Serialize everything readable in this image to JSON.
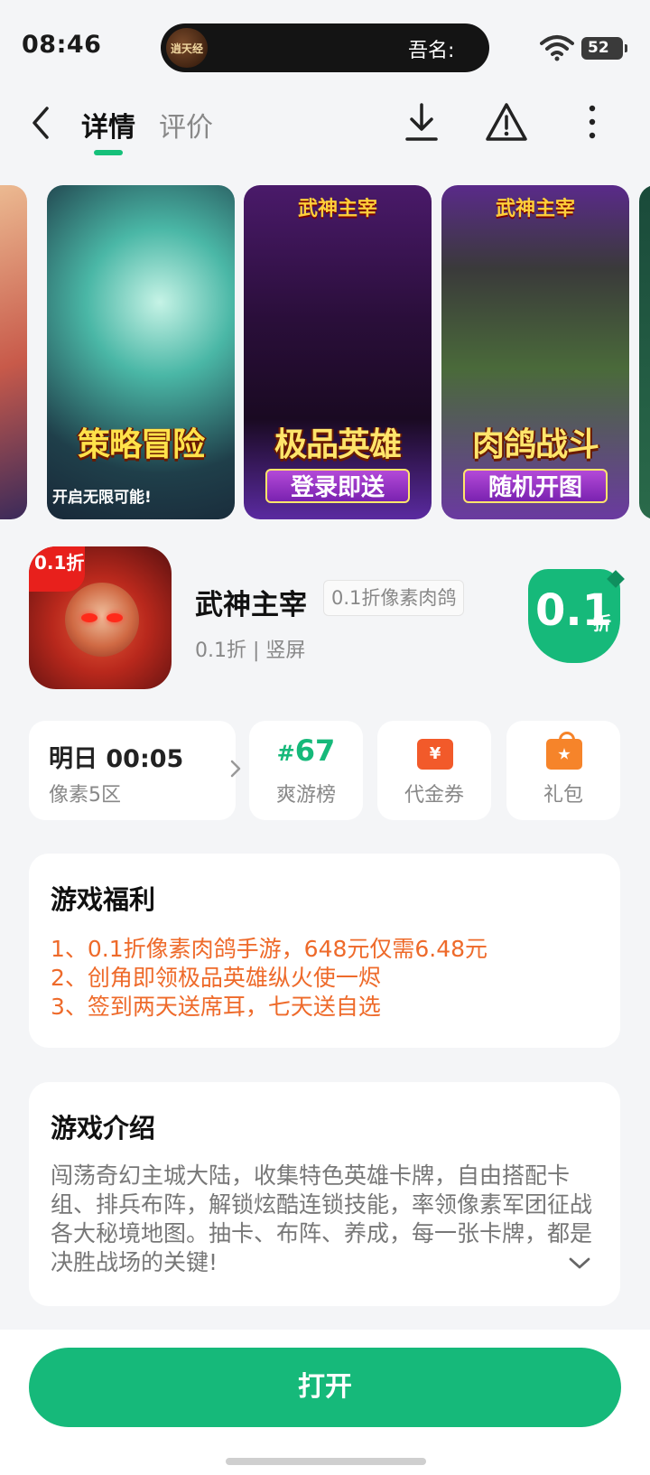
{
  "status_bar": {
    "time": "08:46",
    "island_text": "吾名:",
    "island_logo": "逍天经",
    "battery": "52"
  },
  "nav": {
    "tabs": [
      {
        "label": "详情",
        "active": true
      },
      {
        "label": "评价",
        "active": false
      }
    ],
    "icons": [
      "back-icon",
      "download-icon",
      "warning-icon",
      "more-icon"
    ]
  },
  "screenshots": [
    {
      "banner": "策略冒险",
      "caption": "开启无限可能!"
    },
    {
      "logo": "武神主宰",
      "banner": "极品英雄",
      "sub": "登录即送"
    },
    {
      "logo": "武神主宰",
      "banner": "肉鸽战斗",
      "sub": "随机开图"
    }
  ],
  "app": {
    "icon_badge": "0.1折",
    "name": "武神主宰",
    "tag": "0.1折像素肉鸽",
    "meta": "0.1折 | 竖屏",
    "discount_value": "0.1",
    "discount_unit": "折"
  },
  "cards": {
    "server_time": "明日 00:05",
    "server_zone": "像素5区",
    "rank_hash": "#",
    "rank_number": "67",
    "rank_label": "爽游榜",
    "voucher_symbol": "¥",
    "voucher_label": "代金券",
    "gift_label": "礼包"
  },
  "welfare": {
    "title": "游戏福利",
    "items": [
      "1、0.1折像素肉鸽手游，648元仅需6.48元",
      "2、创角即领极品英雄纵火使一烬",
      "3、签到两天送席耳，七天送自选"
    ]
  },
  "intro": {
    "title": "游戏介绍",
    "text": "闯荡奇幻主城大陆，收集特色英雄卡牌，自由搭配卡组、排兵布阵，解锁炫酷连锁技能，率领像素军团征战各大秘境地图。抽卡、布阵、养成，每一张卡牌，都是决胜战场的关键!"
  },
  "bottom": {
    "open_label": "打开"
  },
  "colors": {
    "accent": "#16b97a",
    "welfare_text": "#ee6a2a"
  }
}
